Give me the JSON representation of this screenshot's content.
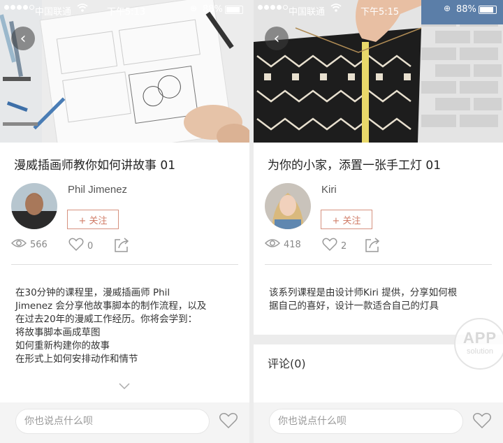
{
  "screens": [
    {
      "status": {
        "carrier": "中国联通",
        "time": "下午5:13",
        "battery": "88%",
        "battery_level": 0.88
      },
      "title": "漫威插画师教你如何讲故事 01",
      "author": {
        "name": "Phil Jimenez",
        "follow_label": "+ 关注"
      },
      "stats": {
        "views": "566",
        "likes": "0"
      },
      "description": "在30分钟的课程里，漫威插画师 Phil\nJimenez 会分享他故事脚本的制作流程，以及\n在过去20年的漫威工作经历。你将会学到：\n将故事脚本画成草图\n如何重新构建你的故事\n在形式上如何安排动作和情节",
      "expand_icon": "chevron-down-icon",
      "comment_placeholder": "你也说点什么呗"
    },
    {
      "status": {
        "carrier": "中国联通",
        "time": "下午5:15",
        "battery": "88%",
        "battery_level": 0.88
      },
      "title": "为你的小家，添置一张手工灯 01",
      "author": {
        "name": "Kiri",
        "follow_label": "+ 关注"
      },
      "stats": {
        "views": "418",
        "likes": "2"
      },
      "description": "该系列课程是由设计师Kiri 提供，分享如何根\n据自己的喜好，设计一款适合自己的灯具",
      "comments_label": "评论(0)",
      "comment_placeholder": "你也说点什么呗"
    }
  ],
  "watermark": {
    "line1": "APP",
    "line2": "solution"
  },
  "colors": {
    "accent": "#d07c67",
    "text": "#333333",
    "muted": "#888888"
  }
}
